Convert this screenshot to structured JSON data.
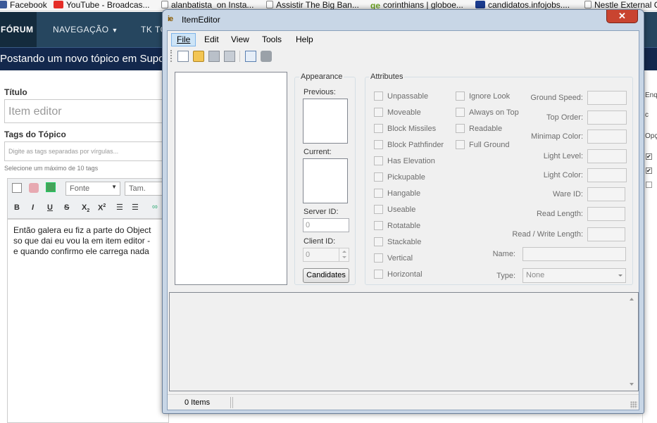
{
  "browser": {
    "bookmarks": [
      {
        "label": "Facebook",
        "icon": "facebook-icon"
      },
      {
        "label": "YouTube - Broadcas...",
        "icon": "youtube-icon"
      },
      {
        "label": "alanbatista_on Insta...",
        "icon": "instagram-icon"
      },
      {
        "label": "Assistir The Big Ban...",
        "icon": "page-icon"
      },
      {
        "label": "corinthians | globoe...",
        "icon": "ge-icon"
      },
      {
        "label": "candidatos.infojobs....",
        "icon": "infojobs-icon"
      },
      {
        "label": "Nestle External C",
        "icon": "page-icon"
      }
    ],
    "nav": {
      "forum": "FÓRUM",
      "navegacao": "NAVEGAÇÃO",
      "tk": "TK TO"
    },
    "topic_header": "Postando um novo tópico em Suport",
    "form": {
      "titulo_label": "Título",
      "title_value": "Item editor",
      "tags_label": "Tags do Tópico",
      "tags_placeholder": "Digite as tags separadas por vírgulas...",
      "tags_hint": "Selecione um máximo de 10 tags",
      "font_select": "Fonte",
      "size_select": "Tam.",
      "body_lines": [
        "Então galera eu fiz a parte do Object",
        "so que dai eu vou la em item editor -",
        "e quando confirmo ele carrega nada"
      ]
    },
    "right_strip": [
      "Enque",
      "c",
      "Opçõ"
    ]
  },
  "window": {
    "title": "ItemEditor",
    "logo": "ie",
    "menu": [
      "File",
      "Edit",
      "View",
      "Tools",
      "Help"
    ],
    "toolbar_icons": [
      "new-file-icon",
      "open-folder-icon",
      "save-icon",
      "save-all-icon",
      "properties-icon",
      "find-icon"
    ],
    "appearance": {
      "legend": "Appearance",
      "previous_label": "Previous:",
      "current_label": "Current:",
      "server_id_label": "Server ID:",
      "server_id_value": "0",
      "client_id_label": "Client ID:",
      "client_id_value": "0",
      "candidates_button": "Candidates"
    },
    "attributes": {
      "legend": "Attributes",
      "checkboxes_col1": [
        "Unpassable",
        "Moveable",
        "Block Missiles",
        "Block Pathfinder",
        "Has Elevation",
        "Pickupable",
        "Hangable",
        "Useable",
        "Rotatable",
        "Stackable",
        "Vertical",
        "Horizontal"
      ],
      "checkboxes_col2": [
        "Ignore Look",
        "Always on Top",
        "Readable",
        "Full Ground"
      ],
      "fields": [
        "Ground Speed:",
        "Top Order:",
        "Minimap Color:",
        "Light Level:",
        "Light Color:",
        "Ware ID:",
        "Read Length:",
        "Read / Write Length:"
      ],
      "name_label": "Name:",
      "type_label": "Type:",
      "type_value": "None"
    },
    "status": {
      "items": "0 Items"
    }
  }
}
